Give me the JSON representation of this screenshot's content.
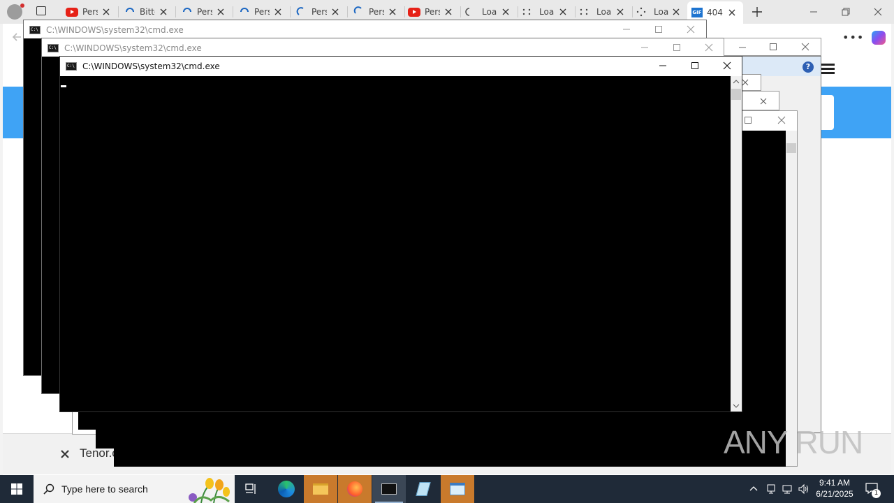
{
  "browser": {
    "tabs": [
      {
        "label": "Pers",
        "icon": "youtube-icon"
      },
      {
        "label": "Bitte",
        "icon": "loading-icon"
      },
      {
        "label": "Pers",
        "icon": "loading-icon"
      },
      {
        "label": "Pers",
        "icon": "loading-icon"
      },
      {
        "label": "Pers",
        "icon": "loading-icon"
      },
      {
        "label": "Pers",
        "icon": "loading-icon"
      },
      {
        "label": "Pers",
        "icon": "youtube-icon"
      },
      {
        "label": "Loa",
        "icon": "loading-icon"
      },
      {
        "label": "Loa",
        "icon": "loading-icon"
      },
      {
        "label": "Loa",
        "icon": "loading-icon"
      },
      {
        "label": "Loa",
        "icon": "loading-icon"
      },
      {
        "label": "404",
        "icon": "gif-icon"
      }
    ],
    "gif_badge": "GIF",
    "bottom_bar_text": "Tenor.c"
  },
  "cmd_windows": [
    {
      "title": "C:\\WINDOWS\\system32\\cmd.exe"
    },
    {
      "title": "C:\\WINDOWS\\system32\\cmd.exe"
    },
    {
      "title": "C:\\WINDOWS\\system32\\cmd.exe"
    }
  ],
  "taskbar": {
    "search_placeholder": "Type here to search",
    "time": "9:41 AM",
    "date": "6/21/2025",
    "notification_count": "1"
  },
  "watermark": "ANY RUN",
  "colors": {
    "taskbar": "#1f2a38",
    "banner": "#3fa3f5",
    "console": "#000000",
    "highlight": "#c97a2c"
  }
}
